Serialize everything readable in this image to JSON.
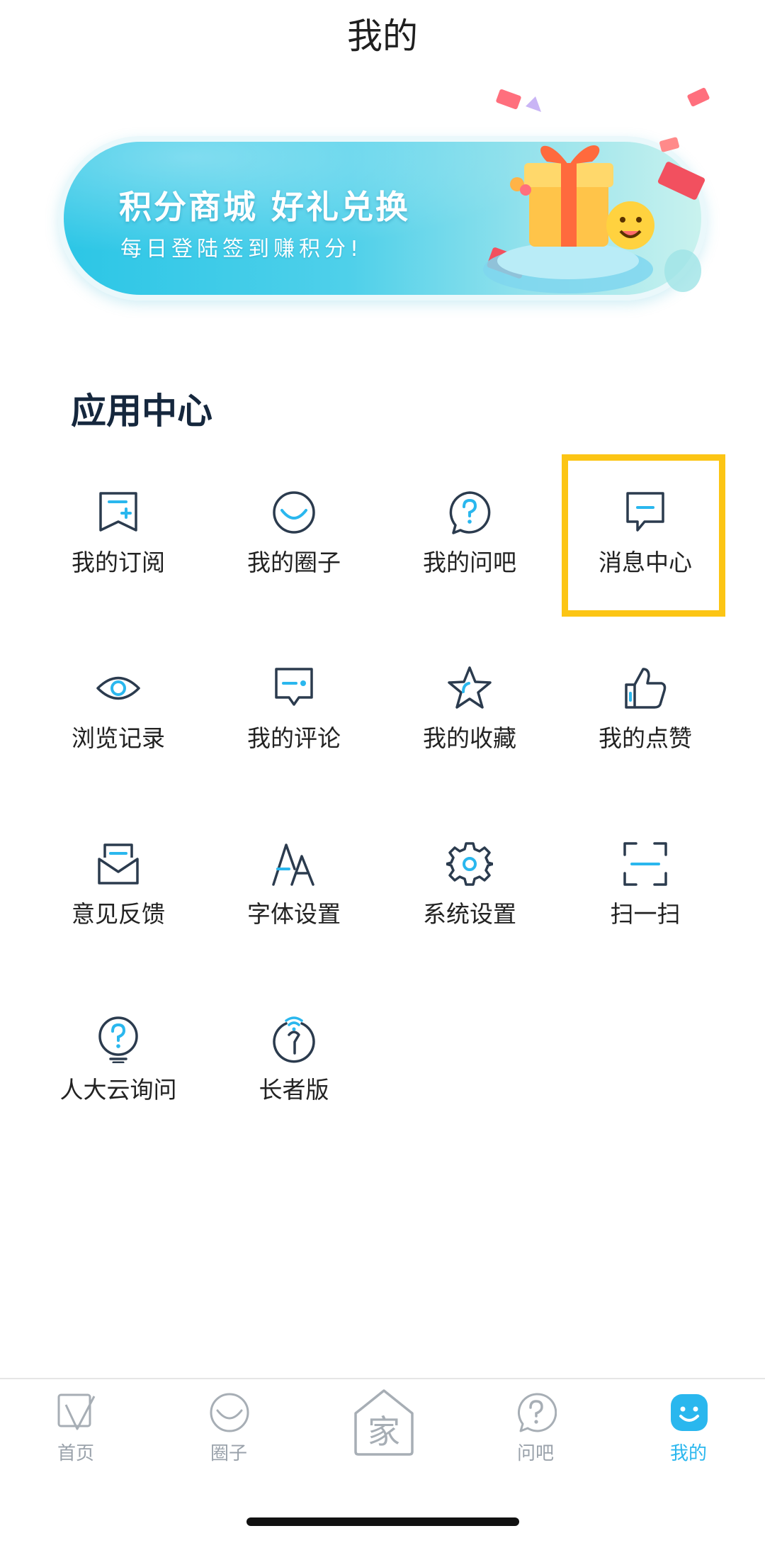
{
  "header": {
    "title": "我的"
  },
  "banner": {
    "title": "积分商城 好礼兑换",
    "subtitle": "每日登陆签到赚积分!"
  },
  "app_center": {
    "title": "应用中心",
    "items": [
      {
        "label": "我的订阅",
        "icon": "subscription-icon"
      },
      {
        "label": "我的圈子",
        "icon": "circle-icon"
      },
      {
        "label": "我的问吧",
        "icon": "question-bubble-icon"
      },
      {
        "label": "消息中心",
        "icon": "message-icon"
      },
      {
        "label": "浏览记录",
        "icon": "eye-icon"
      },
      {
        "label": "我的评论",
        "icon": "comment-icon"
      },
      {
        "label": "我的收藏",
        "icon": "star-icon"
      },
      {
        "label": "我的点赞",
        "icon": "thumbs-up-icon"
      },
      {
        "label": "意见反馈",
        "icon": "feedback-envelope-icon"
      },
      {
        "label": "字体设置",
        "icon": "font-size-icon"
      },
      {
        "label": "系统设置",
        "icon": "gear-icon"
      },
      {
        "label": "扫一扫",
        "icon": "scan-icon"
      },
      {
        "label": "人大云询问",
        "icon": "help-bulb-icon"
      },
      {
        "label": "长者版",
        "icon": "elder-mode-icon"
      }
    ]
  },
  "tabbar": {
    "items": [
      {
        "label": "首页",
        "icon": "home-icon"
      },
      {
        "label": "圈子",
        "icon": "circle-tab-icon"
      },
      {
        "label": "",
        "icon": "jia-home-icon",
        "glyph": "家"
      },
      {
        "label": "问吧",
        "icon": "question-tab-icon"
      },
      {
        "label": "我的",
        "icon": "smiley-profile-icon"
      }
    ],
    "active_index": 4
  },
  "colors": {
    "accent": "#2ab7ee",
    "icon_stroke": "#2b3b4e",
    "highlight": "#fcc514"
  }
}
